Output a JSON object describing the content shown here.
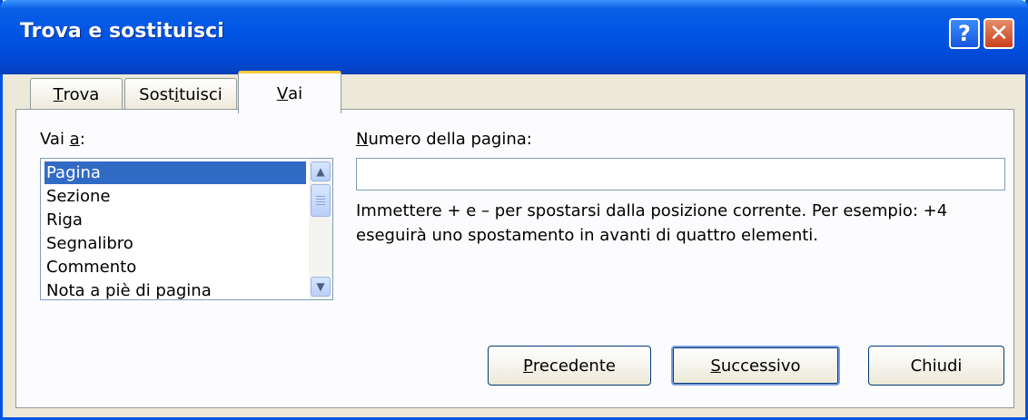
{
  "window": {
    "title": "Trova e sostituisci",
    "help_glyph": "?",
    "close_glyph": "✕"
  },
  "tabs": [
    {
      "label": "Trova",
      "hotkey": "T",
      "rest": "rova"
    },
    {
      "label": "Sostituisci",
      "pre": "Sost",
      "hotkey": "i",
      "rest": "tuisci"
    },
    {
      "label": "Vai",
      "hotkey": "V",
      "rest": "ai"
    }
  ],
  "goto": {
    "label_pre": "Vai ",
    "label_hotkey": "a",
    "label_post": ":",
    "items": [
      "Pagina",
      "Sezione",
      "Riga",
      "Segnalibro",
      "Commento",
      "Nota a piè di pagina"
    ],
    "selected": "Pagina"
  },
  "page_number": {
    "label_hotkey": "N",
    "label_rest": "umero della pagina:",
    "value": "",
    "placeholder": ""
  },
  "description": "Immettere + e – per spostarsi dalla posizione corrente. Per esempio: +4 eseguirà uno spostamento in avanti di quattro elementi.",
  "buttons": {
    "previous_hotkey": "P",
    "previous_rest": "recedente",
    "next_hotkey": "S",
    "next_rest": "uccessivo",
    "close": "Chiudi"
  },
  "icons": {
    "scroll_up": "▲",
    "scroll_down": "▼"
  },
  "colors": {
    "title_bar": "#0055e5",
    "selection": "#316ac5",
    "active_tab_accent": "#ffc83c"
  }
}
